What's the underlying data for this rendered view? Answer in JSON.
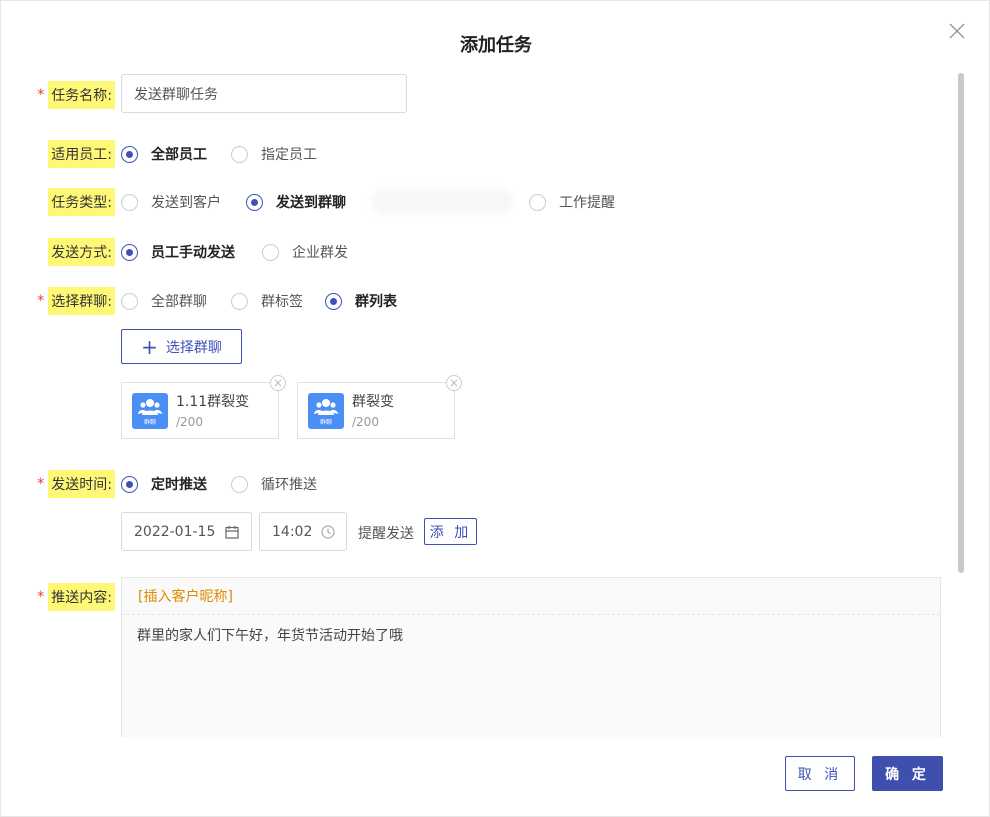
{
  "dialog": {
    "title": "添加任务"
  },
  "fields": {
    "task_name": {
      "label": "任务名称:",
      "value": "发送群聊任务",
      "required": true
    },
    "staff": {
      "label": "适用员工:",
      "options": [
        "全部员工",
        "指定员工"
      ],
      "selected": "全部员工"
    },
    "task_type": {
      "label": "任务类型:",
      "options": [
        "发送到客户",
        "发送到群聊",
        "工作提醒"
      ],
      "selected": "发送到群聊"
    },
    "send_method": {
      "label": "发送方式:",
      "options": [
        "员工手动发送",
        "企业群发"
      ],
      "selected": "员工手动发送"
    },
    "group_select": {
      "label": "选择群聊:",
      "required": true,
      "options": [
        "全部群聊",
        "群标签",
        "群列表"
      ],
      "selected": "群列表",
      "add_button": "选择群聊",
      "groups": [
        {
          "name": "1.11群裂变",
          "count": "/200",
          "avatar_text": "群聊"
        },
        {
          "name": "群裂变",
          "count": "/200",
          "avatar_text": "群聊"
        }
      ]
    },
    "send_time": {
      "label": "发送时间:",
      "required": true,
      "options": [
        "定时推送",
        "循环推送"
      ],
      "selected": "定时推送",
      "date": "2022-01-15",
      "time": "14:02",
      "remind_label": "提醒发送",
      "add_label": "添 加"
    },
    "content": {
      "label": "推送内容:",
      "required": true,
      "insert_label": "[插入客户昵称]",
      "text": "群里的家人们下午好，年货节活动开始了哦"
    }
  },
  "footer": {
    "cancel": "取 消",
    "confirm": "确 定"
  },
  "colors": {
    "primary": "#3f51b5",
    "highlight": "#fff776",
    "required": "#e53935",
    "insert": "#e08a00",
    "avatar": "#4a8ff5"
  }
}
